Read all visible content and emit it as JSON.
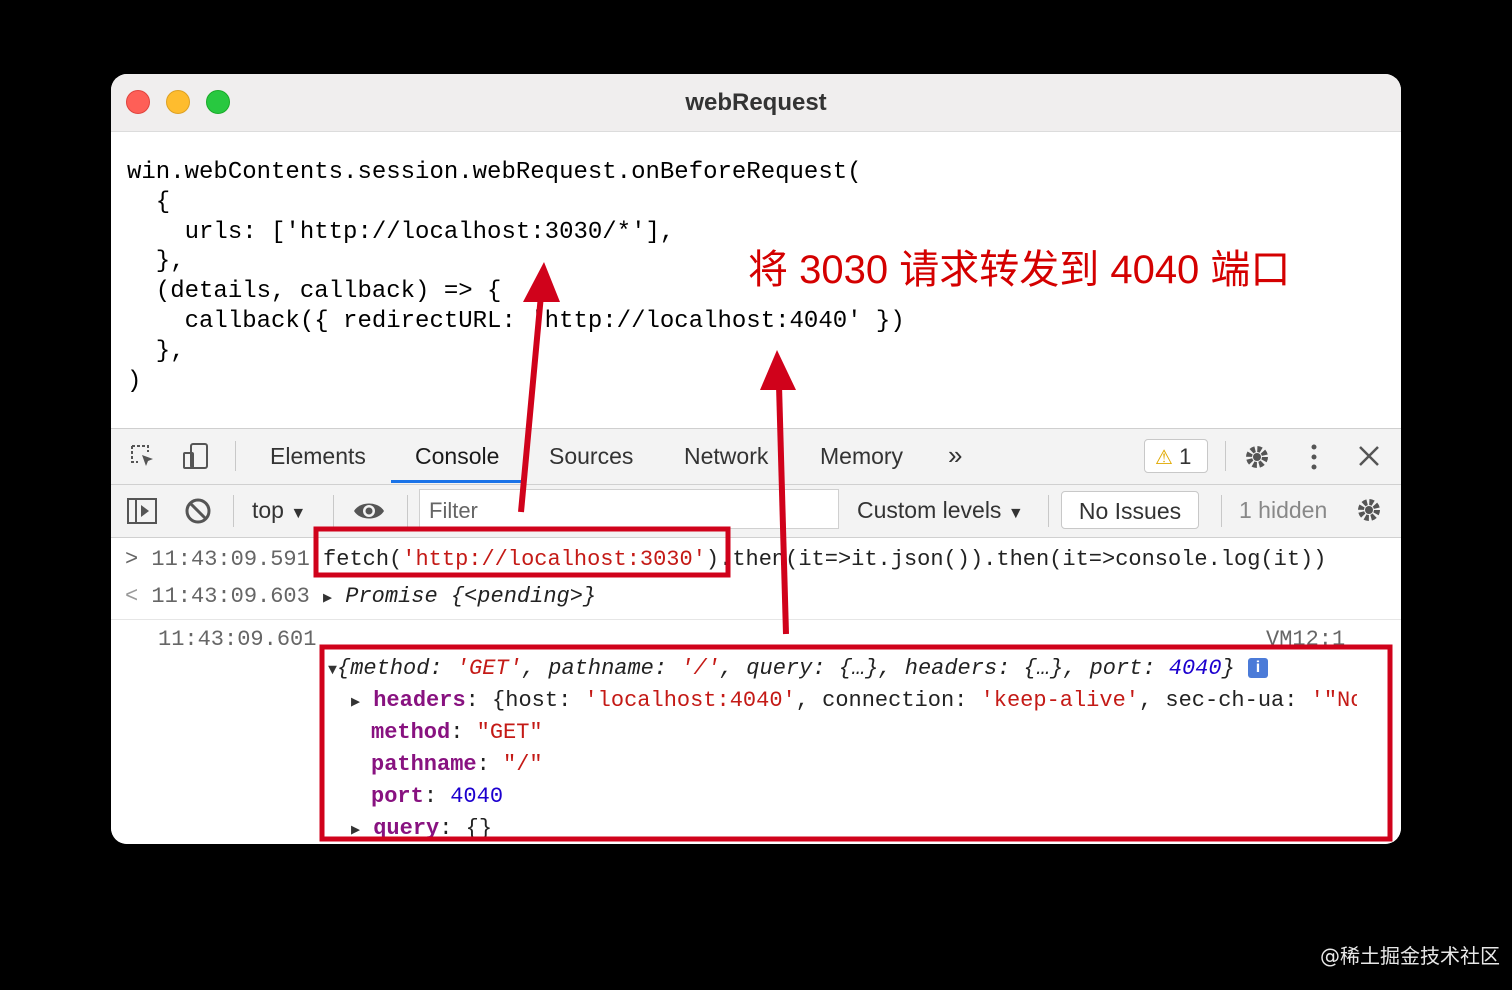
{
  "window": {
    "title": "webRequest"
  },
  "code_lines": [
    "win.webContents.session.webRequest.onBeforeRequest(",
    "  {",
    "    urls: ['http://localhost:3030/*'],",
    "  },",
    "  (details, callback) => {",
    "    callback({ redirectURL: 'http://localhost:4040' })",
    "  },",
    ")"
  ],
  "annotation": "将 3030 请求转发到 4040 端口",
  "devtools": {
    "tabs": [
      "Elements",
      "Console",
      "Sources",
      "Network",
      "Memory"
    ],
    "active_tab": "Console",
    "more_tabs_icon": "chevron-double-right-icon",
    "warnings_count": "1",
    "filterbar": {
      "context": "top",
      "filter_placeholder": "Filter",
      "levels": "Custom levels",
      "issues": "No Issues",
      "hidden": "1 hidden"
    },
    "console": {
      "input": {
        "time": "11:43:09.591",
        "prefix": "fetch(",
        "url": "'http://localhost:3030'",
        "suffix": ").then(it=>it.json()).then(it=>console.log(it))"
      },
      "result": {
        "time": "11:43:09.603",
        "text": "Promise {<pending>}"
      },
      "log": {
        "time": "11:43:09.601",
        "source": "VM12:1",
        "summary": {
          "open": "{method: ",
          "method": "'GET'",
          "mid1": ", pathname: ",
          "pathname": "'/'",
          "mid2": ", query: {…}, headers: {…}, port: ",
          "port": "4040",
          "close": "}"
        },
        "headers": {
          "key": "headers",
          "open": ": {host: ",
          "host": "'localhost:4040'",
          "mid": ", connection: ",
          "connection": "'keep-alive'",
          "mid2": ", sec-ch-ua: ",
          "secchua": "'\"No"
        },
        "method": {
          "key": "method",
          "value": "\"GET\""
        },
        "pathname": {
          "key": "pathname",
          "value": "\"/\""
        },
        "port": {
          "key": "port",
          "value": "4040"
        },
        "query": {
          "key": "query",
          "value": "{}"
        }
      }
    }
  },
  "watermark": "@稀土掘金技术社区",
  "colors": {
    "highlight": "#d0021b",
    "accent": "#1a73e8"
  }
}
